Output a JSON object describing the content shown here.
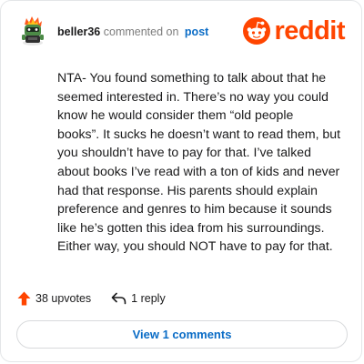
{
  "header": {
    "username": "beller36",
    "action_text": "commented on",
    "post_link": "post",
    "logo_text": "reddit"
  },
  "comment": {
    "body": "NTA- You found something to talk about that he\nseemed interested in. There’s no way you could\nknow he would consider them “old people\nbooks”. It sucks he doesn’t want to read them, but\nyou shouldn’t have to pay for that. I’ve talked\nabout books I’ve read with a ton of kids and never\nhad that response. His parents should explain\npreference and genres to him because it sounds\nlike he’s gotten this idea from his surroundings.\nEither way, you should NOT have to pay for that."
  },
  "footer": {
    "upvotes": "38 upvotes",
    "replies": "1 reply",
    "view_comments": "View 1 comments"
  },
  "icons": {
    "upvote": "upvote-arrow-icon",
    "reply": "reply-arrow-icon",
    "logo": "reddit-snoo-icon"
  },
  "colors": {
    "brand": "#ff4500",
    "link": "#0a6cc6",
    "text": "#1a1a1b",
    "muted": "#7c7c7c"
  }
}
